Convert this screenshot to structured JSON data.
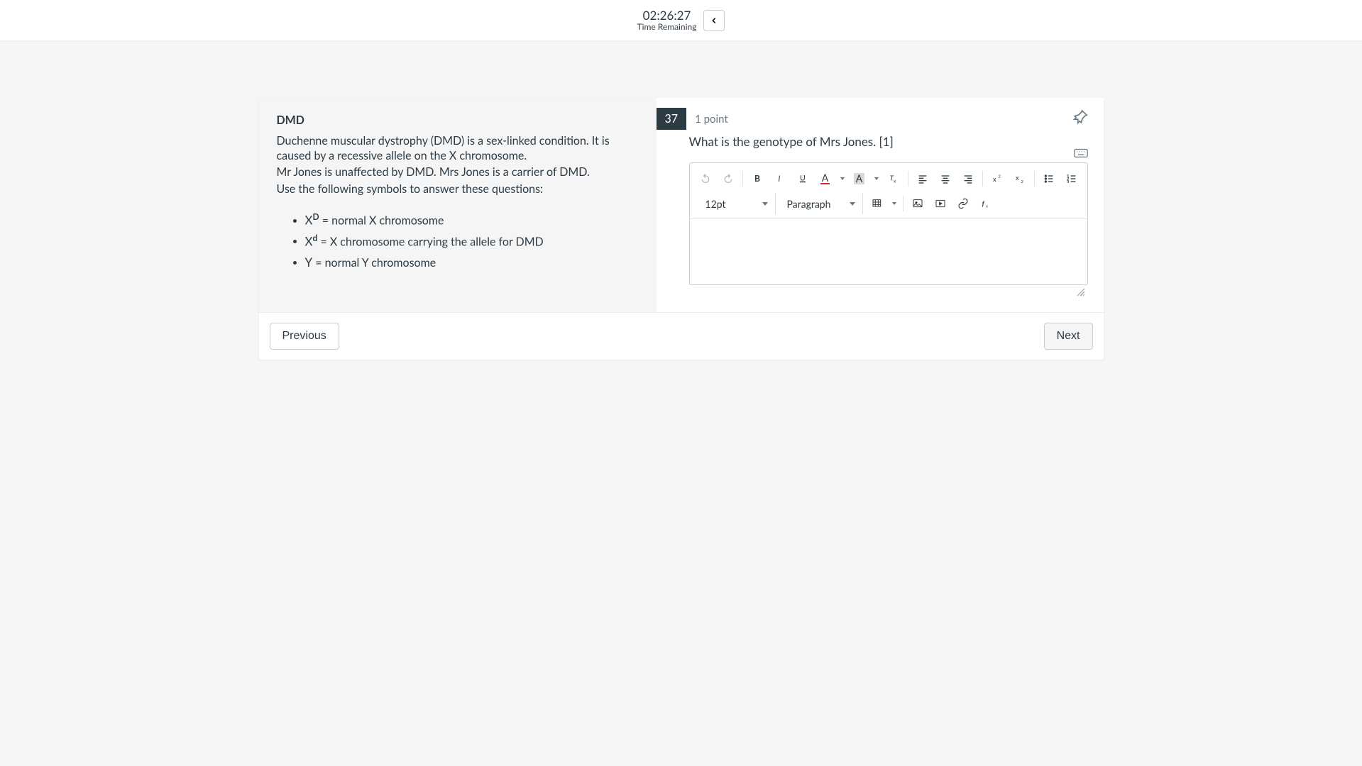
{
  "header": {
    "timer_value": "02:26:27",
    "timer_label": "Time Remaining"
  },
  "left": {
    "title": "DMD",
    "para1": "Duchenne muscular dystrophy (DMD) is a sex-linked condition. It is caused by a recessive allele on the X chromosome.",
    "para2": "Mr Jones is unaffected by DMD. Mrs Jones is a carrier of DMD.",
    "instruction": "Use the following symbols to answer these questions:",
    "symbols": [
      {
        "sym": "X",
        "sup": "D",
        "desc": " = normal X chromosome"
      },
      {
        "sym": "X",
        "sup": "d",
        "desc": " = X chromosome carrying the allele for DMD"
      },
      {
        "sym": "Y",
        "sup": "",
        "desc": " = normal Y chromosome"
      }
    ]
  },
  "question": {
    "number": "37",
    "points": "1 point",
    "text": "What is the genotype of Mrs Jones. [1]"
  },
  "toolbar": {
    "fontsize": "12pt",
    "block": "Paragraph"
  },
  "footer": {
    "prev": "Previous",
    "next": "Next"
  }
}
